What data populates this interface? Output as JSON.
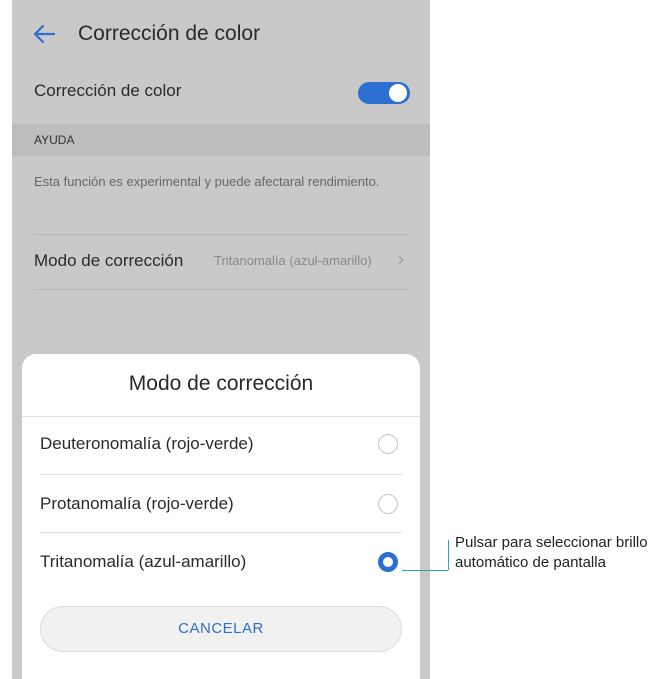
{
  "app_bar": {
    "title": "Corrección de color",
    "back_icon": "arrow-left-icon"
  },
  "settings": {
    "toggle_label": "Corrección de color",
    "toggle_state": "on",
    "section_header": "AYUDA",
    "help_text": "Esta función es experimental y puede afectaral rendimiento.",
    "mode_label": "Modo de corrección",
    "mode_value": "Tritanomalía (azul-amarillo)",
    "chevron": "›"
  },
  "dialog": {
    "title": "Modo de corrección",
    "options": [
      {
        "label": "Deuteronomalía (rojo-verde)",
        "selected": false
      },
      {
        "label": "Protanomalía (rojo-verde)",
        "selected": false
      },
      {
        "label": "Tritanomalía (azul-amarillo)",
        "selected": true
      }
    ],
    "cancel_label": "CANCELAR"
  },
  "callout": {
    "text": "Pulsar para seleccionar brillo automático de pantalla"
  },
  "colors": {
    "accent": "#2c6fd0",
    "callout_line": "#2aa6b8",
    "overlay": "#c9c9c9"
  }
}
